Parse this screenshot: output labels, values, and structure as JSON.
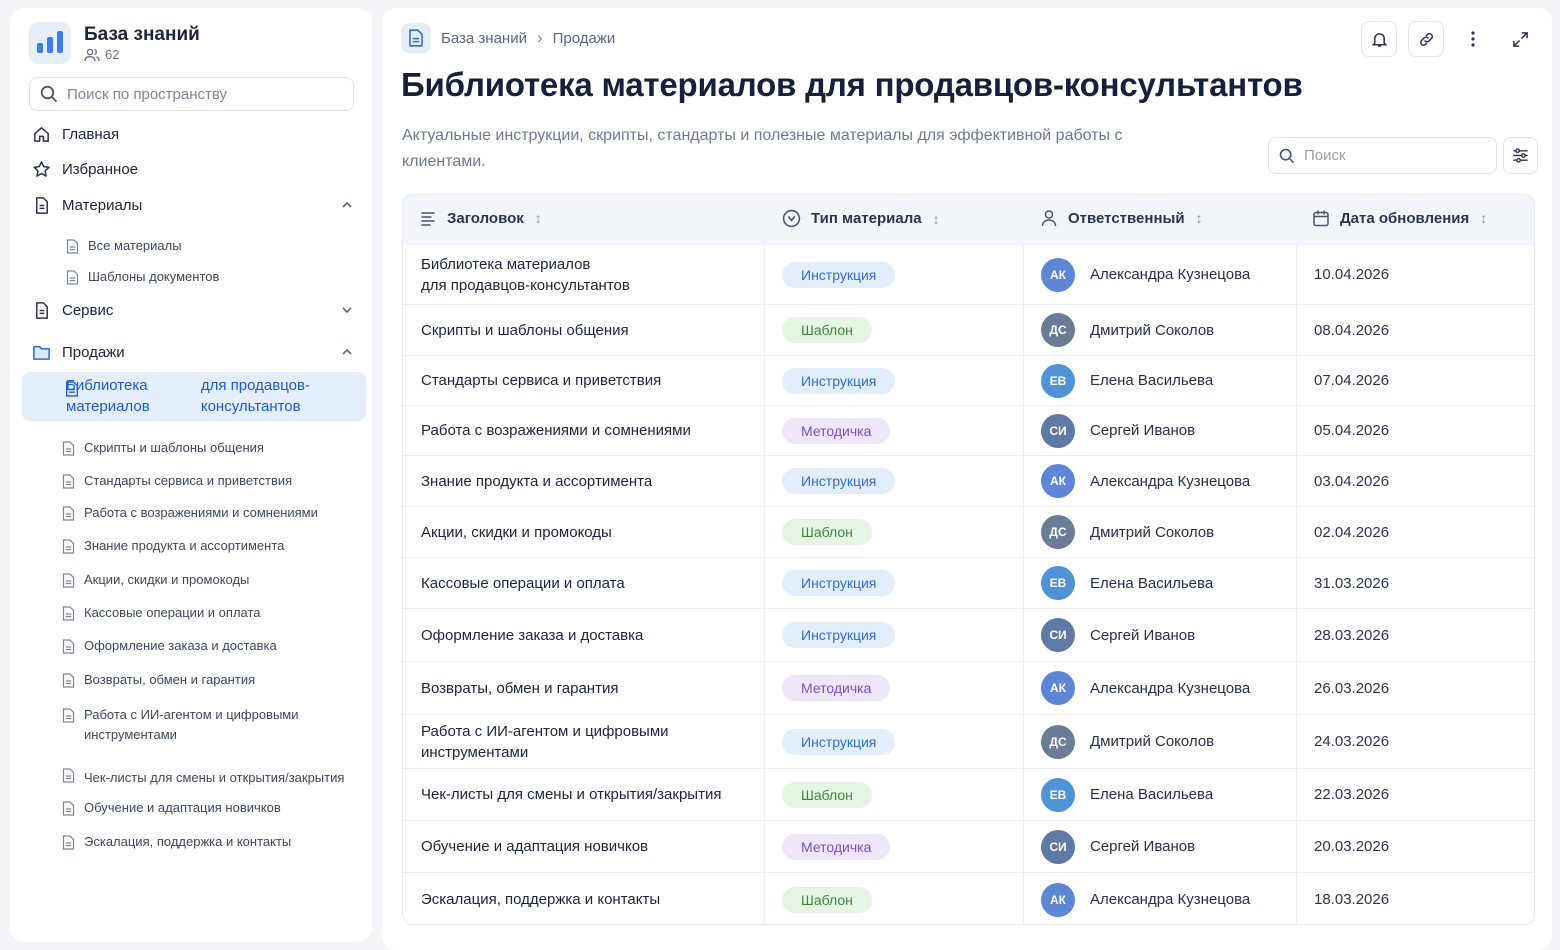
{
  "space": {
    "name": "База знаний",
    "members": "62"
  },
  "sidebar": {
    "search_placeholder": "Поиск по пространству",
    "home": "Главная",
    "favorites": "Избранное",
    "materials": {
      "label": "Материалы",
      "items": [
        "Все материалы",
        "Шаблоны документов"
      ]
    },
    "service": "Сервис",
    "sales": {
      "label": "Продажи",
      "active_item": [
        "Библиотека материалов",
        "для продавцов-консультантов"
      ],
      "items": [
        "Скрипты и шаблоны общения",
        "Стандарты сервиса и приветствия",
        "Работа с возражениями и сомнениями",
        "Знание продукта и ассортимента",
        "Акции, скидки и промокоды",
        "Кассовые операции и оплата",
        "Оформление заказа и доставка",
        "Возвраты, обмен и гарантия",
        "Работа с ИИ-агентом и цифровыми инструментами",
        "Чек-листы для смены и открытия/закрытия",
        "Обучение и адаптация новичков",
        "Эскалация, поддержка и контакты"
      ]
    }
  },
  "breadcrumb": {
    "root": "База знаний",
    "separator": "›",
    "current": "Продажи"
  },
  "page": {
    "title": "Библиотека материалов для продавцов-консультантов",
    "description": "Актуальные инструкции, скрипты, стандарты и полезные материалы для эффективной работы с клиентами."
  },
  "table": {
    "search_placeholder": "Поиск",
    "sort_glyph": "↕",
    "columns": {
      "title": "Заголовок",
      "type": "Тип материала",
      "owner": "Ответственный",
      "date": "Дата обновления"
    },
    "rows": [
      {
        "title": "Библиотека материалов\nдля продавцов-консультантов",
        "type": "Инструкция",
        "initials": "АК",
        "owner": "Александра Кузнецова",
        "date": "10.04.2026"
      },
      {
        "title": "Скрипты и шаблоны общения",
        "type": "Шаблон",
        "initials": "ДС",
        "owner": "Дмитрий Соколов",
        "date": "08.04.2026"
      },
      {
        "title": "Стандарты сервиса и приветствия",
        "type": "Инструкция",
        "initials": "ЕВ",
        "owner": "Елена Васильева",
        "date": "07.04.2026"
      },
      {
        "title": "Работа с возражениями и сомнениями",
        "type": "Методичка",
        "initials": "СИ",
        "owner": "Сергей Иванов",
        "date": "05.04.2026"
      },
      {
        "title": "Знание продукта и ассортимента",
        "type": "Инструкция",
        "initials": "АК",
        "owner": "Александра Кузнецова",
        "date": "03.04.2026"
      },
      {
        "title": "Акции, скидки и промокоды",
        "type": "Шаблон",
        "initials": "ДС",
        "owner": "Дмитрий Соколов",
        "date": "02.04.2026"
      },
      {
        "title": "Кассовые операции и оплата",
        "type": "Инструкция",
        "initials": "ЕВ",
        "owner": "Елена Васильева",
        "date": "31.03.2026"
      },
      {
        "title": "Оформление заказа и доставка",
        "type": "Инструкция",
        "initials": "СИ",
        "owner": "Сергей Иванов",
        "date": "28.03.2026"
      },
      {
        "title": "Возвраты, обмен и гарантия",
        "type": "Методичка",
        "initials": "АК",
        "owner": "Александра Кузнецова",
        "date": "26.03.2026"
      },
      {
        "title": "Работа с ИИ-агентом и цифровыми инструментами",
        "type": "Инструкция",
        "initials": "ДС",
        "owner": "Дмитрий Соколов",
        "date": "24.03.2026"
      },
      {
        "title": "Чек-листы для смены и открытия/закрытия",
        "type": "Шаблон",
        "initials": "ЕВ",
        "owner": "Елена Васильева",
        "date": "22.03.2026"
      },
      {
        "title": "Обучение и адаптация новичков",
        "type": "Методичка",
        "initials": "СИ",
        "owner": "Сергей Иванов",
        "date": "20.03.2026"
      },
      {
        "title": "Эскалация, поддержка и контакты",
        "type": "Шаблон",
        "initials": "АК",
        "owner": "Александра Кузнецова",
        "date": "18.03.2026"
      }
    ]
  },
  "colors": {
    "accent": "#1e5bd8",
    "badges": {
      "Инструкция": {
        "bg": "#e3eefc",
        "fg": "#2f6fd6"
      },
      "Шаблон": {
        "bg": "#e5f5e3",
        "fg": "#3a8a3a"
      },
      "Методичка": {
        "bg": "#efe6fb",
        "fg": "#7a4fc8"
      }
    },
    "avatars": {
      "АК": "#5d86d6",
      "ДС": "#6b7c96",
      "ЕВ": "#4f92d6",
      "СИ": "#5f7aa6"
    }
  },
  "icons": {
    "space_logo": "bar-chart-icon",
    "members": "users-icon",
    "search": "search-icon",
    "home": "home-icon",
    "favorites": "star-icon",
    "document": "document-icon",
    "folder": "folder-icon",
    "bell": "bell-icon",
    "link": "link-icon",
    "more": "more-vertical-icon",
    "expand": "expand-icon",
    "filter": "filter-icon",
    "title_col": "list-icon",
    "type_col": "tag-circle-icon",
    "owner_col": "user-icon",
    "date_col": "calendar-icon"
  }
}
